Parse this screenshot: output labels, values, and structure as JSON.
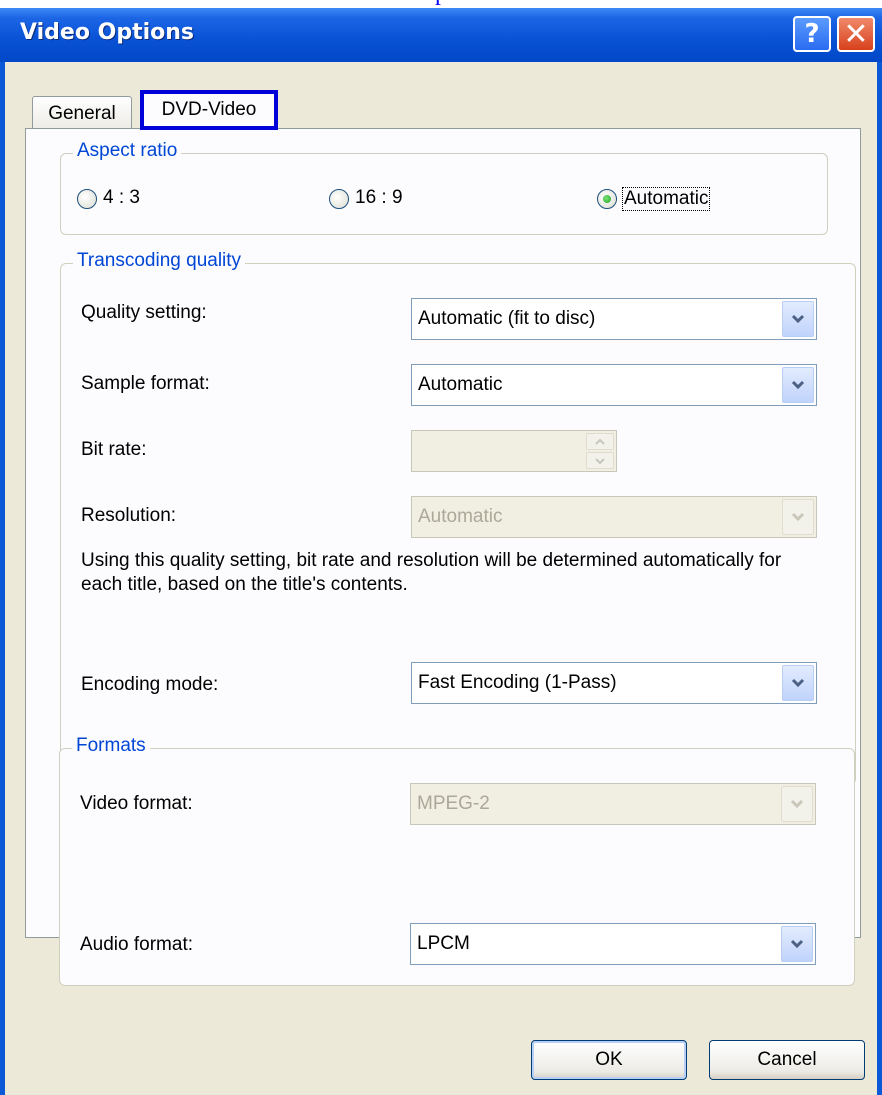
{
  "top_link": "p",
  "window": {
    "title": "Video Options"
  },
  "tabs": [
    {
      "label": "General",
      "selected": false
    },
    {
      "label": "DVD-Video",
      "selected": true
    }
  ],
  "aspect_ratio": {
    "title": "Aspect ratio",
    "options": [
      {
        "label": "4 : 3",
        "checked": false
      },
      {
        "label": "16 : 9",
        "checked": false
      },
      {
        "label": "Automatic",
        "checked": true
      }
    ]
  },
  "transcoding": {
    "title": "Transcoding quality",
    "quality_label": "Quality setting:",
    "quality_value": "Automatic (fit to disc)",
    "sample_label": "Sample format:",
    "sample_value": "Automatic",
    "bitrate_label": "Bit rate:",
    "bitrate_value": "",
    "resolution_label": "Resolution:",
    "resolution_value": "Automatic",
    "info_text": "Using this quality setting, bit rate and resolution will be determined automatically for each title, based on the title's contents.",
    "encoding_label": "Encoding mode:",
    "encoding_value": "Fast Encoding (1-Pass)"
  },
  "formats": {
    "title": "Formats",
    "video_label": "Video format:",
    "video_value": "MPEG-2",
    "audio_label": "Audio format:",
    "audio_value": "LPCM"
  },
  "buttons": {
    "ok": "OK",
    "cancel": "Cancel"
  },
  "colors": {
    "titlebar": "#0a53d6",
    "group_title": "#0046d5",
    "tab_highlight": "#0000d8",
    "dialog_bg": "#ece9d8"
  },
  "icons": {
    "help": "help-icon",
    "close": "close-icon",
    "dropdown": "chevron-down-icon"
  }
}
